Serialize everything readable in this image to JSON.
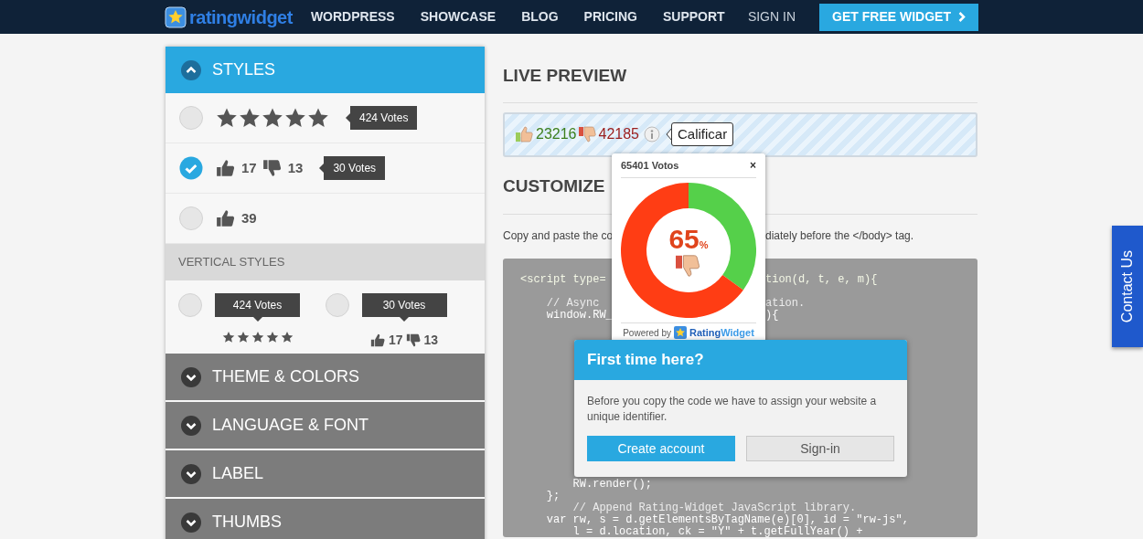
{
  "nav": {
    "logo": "ratingwidget",
    "links": [
      "WORDPRESS",
      "SHOWCASE",
      "BLOG",
      "PRICING",
      "SUPPORT"
    ],
    "sign_in": "SIGN IN",
    "cta": "GET FREE WIDGET"
  },
  "panel": {
    "sections": [
      {
        "title": "STYLES",
        "expanded": true,
        "options": [
          {
            "kind": "stars",
            "selected": false,
            "stars": 5,
            "votes": "424 Votes"
          },
          {
            "kind": "thumbs",
            "selected": true,
            "up": "17",
            "down": "13",
            "votes": "30 Votes"
          },
          {
            "kind": "like",
            "selected": false,
            "up": "39"
          }
        ],
        "vertical_heading": "VERTICAL STYLES",
        "vertical_options": [
          {
            "kind": "stars",
            "selected": false,
            "stars": 5,
            "votes": "424 Votes"
          },
          {
            "kind": "thumbs",
            "selected": false,
            "up": "17",
            "down": "13",
            "votes": "30 Votes"
          }
        ]
      },
      {
        "title": "THEME & COLORS",
        "expanded": false
      },
      {
        "title": "LANGUAGE & FONT",
        "expanded": false
      },
      {
        "title": "LABEL",
        "expanded": false
      },
      {
        "title": "THUMBS",
        "expanded": false
      }
    ]
  },
  "preview": {
    "heading": "LIVE PREVIEW",
    "up_count": "23216",
    "down_count": "42185",
    "button": "Calificar",
    "popup": {
      "title": "65401 Votos",
      "close": "×",
      "chart_data": {
        "type": "donut",
        "values": [
          35,
          65
        ]
      },
      "percent": "65",
      "percent_sign": "%",
      "powered_by": "Powered by",
      "brand_first": "Rating",
      "brand_second": "Widget"
    }
  },
  "customize": {
    "heading": "CUSTOMIZE",
    "instructions_left": "Copy and paste the co",
    "instructions_right": "diately before the </body> tag.",
    "code_blocks": [
      [
        {
          "kind": "tag",
          "left": "<script type=",
          "right": "tion(d, t, e, m){"
        }
      ],
      [
        {
          "kind": "comment",
          "left": "    // Async",
          "right": "ation."
        },
        {
          "kind": "code",
          "left": "    window.RW_",
          "right": "){"
        }
      ],
      [
        {
          "kind": "code",
          "text": "        RW.render();"
        },
        {
          "kind": "code",
          "text": "    };"
        },
        {
          "kind": "comment",
          "text": "        // Append Rating-Widget JavaScript library."
        },
        {
          "kind": "code",
          "text": "    var rw, s = d.getElementsByTagName(e)[0], id = \"rw-js\","
        },
        {
          "kind": "code",
          "text": "        l = d.location, ck = \"Y\" + t.getFullYear() +"
        }
      ]
    ]
  },
  "dialog": {
    "title": "First time here?",
    "text": "Before you copy the code we have to assign your website a unique identifier.",
    "primary": "Create account",
    "secondary": "Sign-in"
  },
  "contact_tab": "Contact Us"
}
